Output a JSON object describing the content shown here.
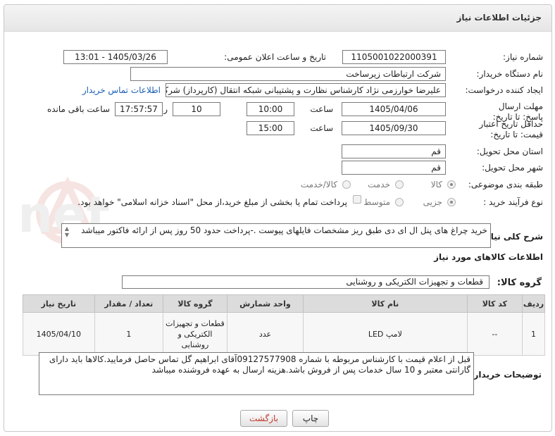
{
  "header": {
    "title": "جزئیات اطلاعات نیاز"
  },
  "labels": {
    "need_number": "شماره نیاز:",
    "announce_datetime": "تاریخ و ساعت اعلان عمومی:",
    "buyer_org": "نام دستگاه خریدار:",
    "requester": "ایجاد کننده درخواست:",
    "reply_deadline": "مهلت ارسال پاسخ: تا تاریخ:",
    "price_validity": "حداقل تاریخ اعتبار قیمت: تا تاریخ:",
    "time_word": "ساعت",
    "days_and": "روز و",
    "remaining": "ساعت باقی مانده",
    "province": "استان محل تحویل:",
    "city": "شهر محل تحویل:",
    "category": "طبقه بندی موضوعی:",
    "process_type": "نوع فرآیند خرید :",
    "general_desc": "شرح کلی نیاز:",
    "goods_info": "اطلاعات کالاهای مورد نیاز",
    "goods_group": "گروه کالا:",
    "buyer_notes": "توضیحات خریدار:"
  },
  "fields": {
    "need_number": "1105001022000391",
    "announce_datetime": "1405/03/26 - 13:01",
    "buyer_org": "شرکت ارتباطات زیرساخت",
    "requester": "علیرضا خوارزمی نژاد  کارشناس نظارت و پشتیبانی شبکه انتقال (کارپرداز) شرکت ارتباطات زیرساخت",
    "contact_link": "اطلاعات تماس خریدار",
    "reply_date": "1405/04/06",
    "reply_time": "10:00",
    "days_left": "10",
    "time_left": "17:57:57",
    "validity_date": "1405/09/30",
    "validity_time": "15:00",
    "province": "قم",
    "city": "قم",
    "general_desc": "خرید چراغ های پنل ال ای دی طبق ریز مشخصات فایلهای پیوست .-پرداخت حدود 50 روز پس از ارائه فاکتور میباشد",
    "goods_group": "قطعات و تجهیزات الکتریکی و روشنایی",
    "buyer_notes": "قبل از اعلام قیمت با کارشناس مربوطه با شماره 09127577908آقای ابراهیم گل تماس حاصل فرمایید.کالاها باید دارای گارانتی معتبر و 10 سال خدمات پس از فروش باشد.هزینه ارسال به عهده فروشنده میباشد"
  },
  "category_options": [
    {
      "label": "کالا",
      "selected": true
    },
    {
      "label": "خدمت",
      "selected": false
    },
    {
      "label": "کالا/خدمت",
      "selected": false
    }
  ],
  "process_options": [
    {
      "label": "جزیی",
      "selected": true
    },
    {
      "label": "متوسط",
      "selected": false
    }
  ],
  "treasury_note": "پرداخت تمام یا بخشی از مبلغ خرید،از محل \"اسناد خزانه اسلامی\" خواهد بود.",
  "table": {
    "headers": [
      "ردیف",
      "کد کالا",
      "نام کالا",
      "واحد شمارش",
      "گروه کالا",
      "تعداد / مقدار",
      "تاریخ نیاز"
    ],
    "rows": [
      [
        "1",
        "--",
        "لامپ LED",
        "عدد",
        "قطعات و تجهیزات الکتریکی و روشنایی",
        "1",
        "1405/04/10"
      ]
    ]
  },
  "buttons": {
    "print": "چاپ",
    "back": "بازگشت"
  },
  "watermark_text": "AriaTender.net",
  "colors": {
    "link": "#1a5fb4",
    "back_button_text": "#c0392b",
    "table_header": "#dcdcdc"
  }
}
